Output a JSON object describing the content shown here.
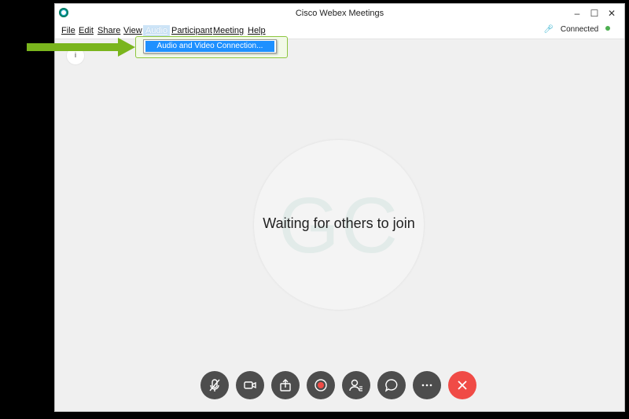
{
  "window": {
    "title": "Cisco Webex Meetings"
  },
  "menu": {
    "items": [
      {
        "label": "File"
      },
      {
        "label": "Edit"
      },
      {
        "label": "Share"
      },
      {
        "label": "View"
      },
      {
        "label": "Audio"
      },
      {
        "label": "Participant"
      },
      {
        "label": "Meeting"
      },
      {
        "label": "Help"
      }
    ],
    "active": "Audio"
  },
  "status": {
    "text": "Connected"
  },
  "dropdown": {
    "item": "Audio and Video Connection..."
  },
  "main": {
    "initials": "GC",
    "waiting_text": "Waiting for others to join"
  },
  "controls": [
    {
      "icon": "mute-mic-icon"
    },
    {
      "icon": "video-camera-icon"
    },
    {
      "icon": "share-icon"
    },
    {
      "icon": "record-icon"
    },
    {
      "icon": "participants-icon"
    },
    {
      "icon": "chat-icon"
    },
    {
      "icon": "more-icon"
    },
    {
      "icon": "end-call-icon"
    }
  ],
  "colors": {
    "accent": "#1ca9c9",
    "end_call": "#f04b46",
    "highlight": "#1e90ff",
    "arrow": "#7ab51d"
  }
}
